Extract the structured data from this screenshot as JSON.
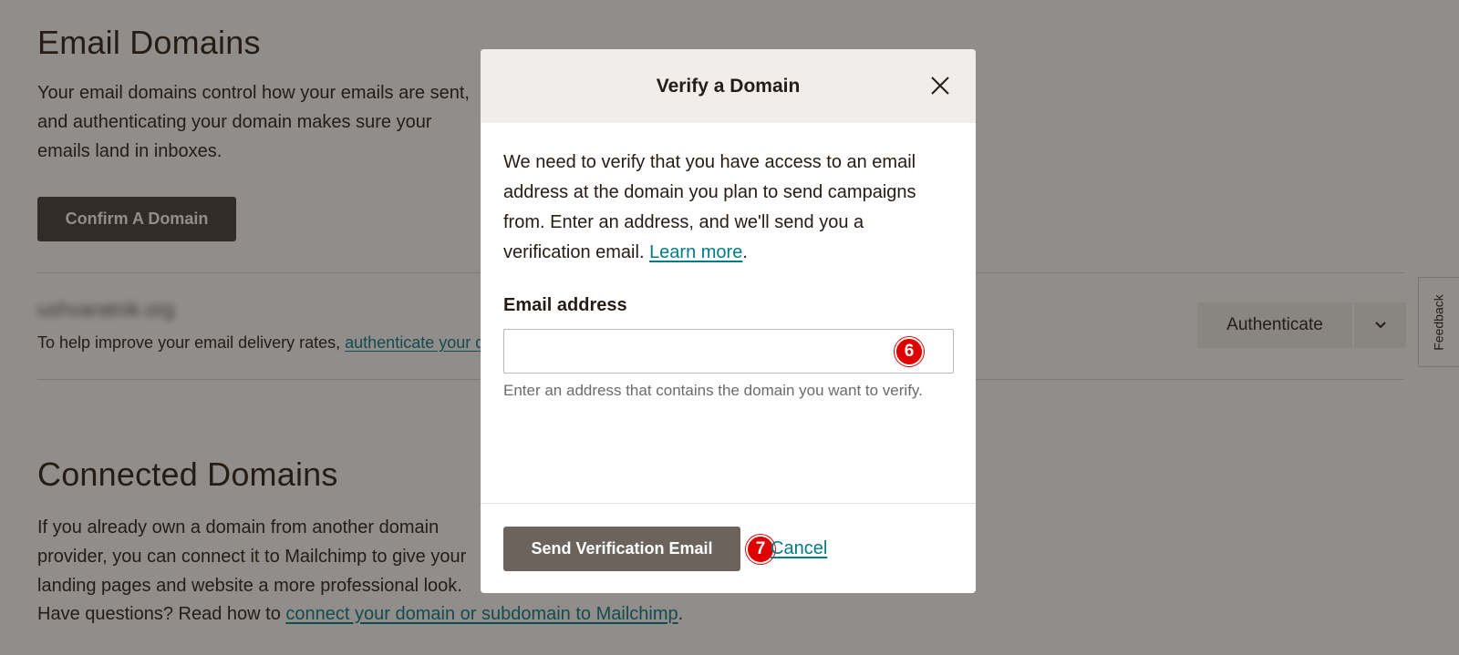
{
  "page": {
    "email_domains": {
      "title": "Email Domains",
      "description": "Your email domains control how your emails are sent, and authenticating your domain makes sure your emails land in inboxes.",
      "confirm_button": "Confirm A Domain",
      "domain_name": "ushvaratnik.org",
      "note_prefix": "To help improve your email delivery rates, ",
      "note_link": "authenticate your domain",
      "authenticate_button": "Authenticate"
    },
    "connected_domains": {
      "title": "Connected Domains",
      "description": "If you already own a domain from another domain provider, you can connect it to Mailchimp to give your landing pages and website a more professional look.",
      "questions_prefix": "Have questions? Read how to ",
      "questions_link": "connect your domain or subdomain to Mailchimp",
      "questions_suffix": "."
    },
    "feedback_tab": "Feedback"
  },
  "modal": {
    "title": "Verify a Domain",
    "description": "We need to verify that you have access to an email address at the domain you plan to send campaigns from. Enter an address, and we'll send you a verification email. ",
    "learn_more": "Learn more",
    "learn_more_suffix": ".",
    "email_label": "Email address",
    "email_value": "",
    "email_helper": "Enter an address that contains the domain you want to verify.",
    "send_button": "Send Verification Email",
    "cancel_link": "Cancel"
  },
  "step_markers": {
    "input": "6",
    "send": "7"
  },
  "colors": {
    "overlay": "rgba(36,28,21,0.5)",
    "primary_button": "#403b3b",
    "send_button": "#6b635c",
    "link": "#007c89",
    "marker": "#e00000",
    "modal_header": "#f0edea"
  }
}
